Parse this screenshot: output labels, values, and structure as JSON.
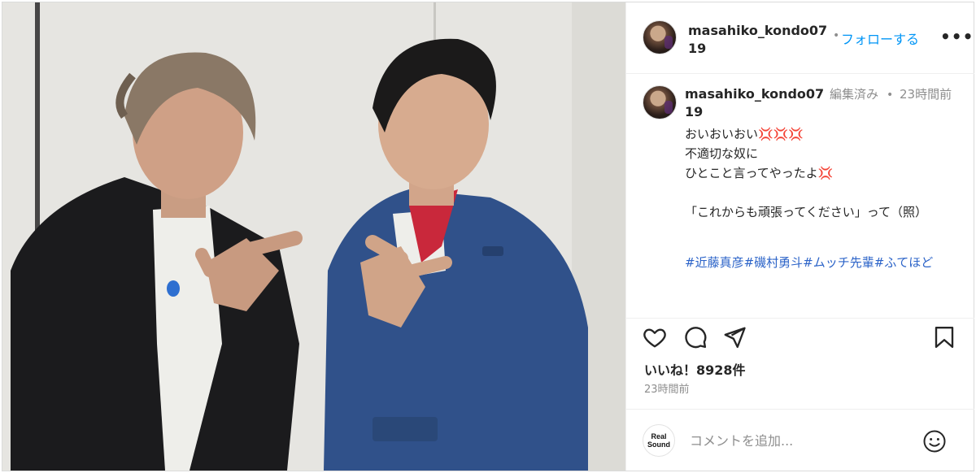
{
  "post": {
    "username": "masahiko_kondo0719",
    "follow_label": "フォローする",
    "more_label": "•••",
    "separator": "•"
  },
  "caption": {
    "username": "masahiko_kondo0719",
    "edited": "編集済み",
    "separator": "•",
    "time": "23時間前",
    "lines": [
      {
        "text": "おいおいおい",
        "emoji": "💢💢💢"
      },
      {
        "text": "不適切な奴に",
        "emoji": ""
      },
      {
        "text": "ひとこと言ってやったよ",
        "emoji": "💢"
      },
      {
        "text": "",
        "emoji": ""
      },
      {
        "text": "「これからも頑張ってください」って（照）",
        "emoji": ""
      }
    ],
    "hashtags": [
      "#近藤真彦",
      "#磯村勇斗",
      "#ムッチ先輩",
      "#ふてほど"
    ]
  },
  "actions": {
    "likes": "いいね！8928件",
    "time": "23時間前",
    "icons": [
      "heart-icon",
      "comment-icon",
      "share-icon",
      "bookmark-icon"
    ]
  },
  "comment": {
    "logo_text": "Real Sound",
    "placeholder": "コメントを追加...",
    "emoji_icon": "smiley-icon"
  },
  "colors": {
    "accent": "#0095f6",
    "muted": "#8e8e8e",
    "hashtag": "#2b63c8",
    "anger": "#e0245e"
  }
}
